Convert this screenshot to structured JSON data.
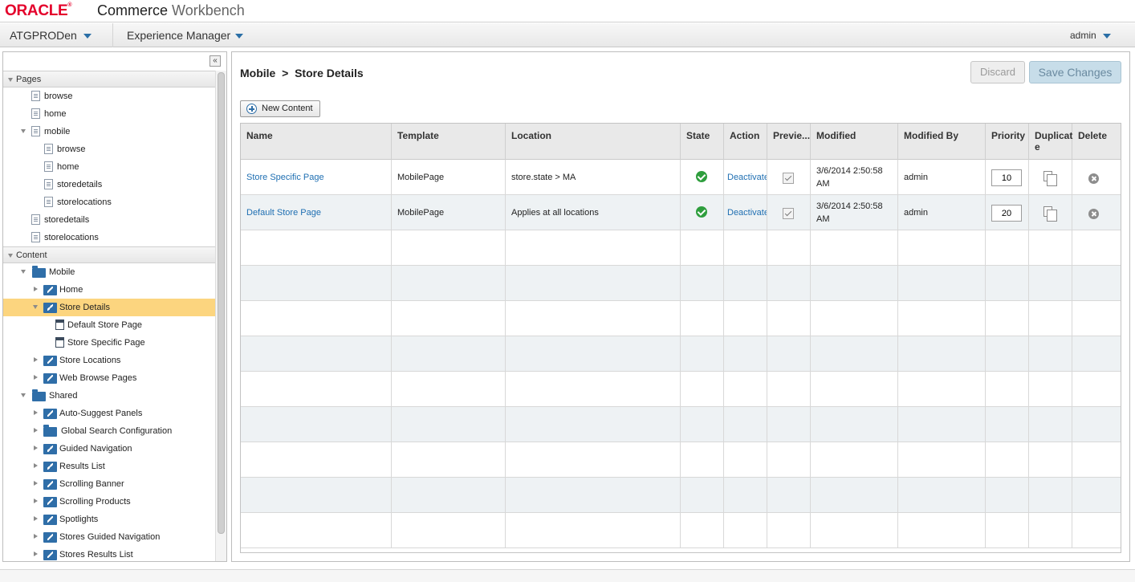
{
  "brand": {
    "oracle": "ORACLE",
    "app_bold": "Commerce",
    "app_light": "Workbench"
  },
  "nav": {
    "site": "ATGPRODen",
    "tool": "Experience Manager",
    "user": "admin"
  },
  "sidebar": {
    "collapse_glyph": "«",
    "pages_header": "Pages",
    "pages": [
      {
        "label": "browse"
      },
      {
        "label": "home"
      },
      {
        "label": "mobile"
      },
      {
        "label": "browse"
      },
      {
        "label": "home"
      },
      {
        "label": "storedetails"
      },
      {
        "label": "storelocations"
      },
      {
        "label": "storedetails"
      },
      {
        "label": "storelocations"
      }
    ],
    "content_header": "Content",
    "content": [
      {
        "label": "Mobile"
      },
      {
        "label": "Home"
      },
      {
        "label": "Store Details"
      },
      {
        "label": "Default Store Page"
      },
      {
        "label": "Store Specific Page"
      },
      {
        "label": "Store Locations"
      },
      {
        "label": "Web Browse Pages"
      },
      {
        "label": "Shared"
      },
      {
        "label": "Auto-Suggest Panels"
      },
      {
        "label": "Global Search Configuration"
      },
      {
        "label": "Guided Navigation"
      },
      {
        "label": "Results List"
      },
      {
        "label": "Scrolling Banner"
      },
      {
        "label": "Scrolling Products"
      },
      {
        "label": "Spotlights"
      },
      {
        "label": "Stores Guided Navigation"
      },
      {
        "label": "Stores Results List"
      }
    ]
  },
  "main": {
    "breadcrumb": "Mobile  >  Store Details",
    "discard": "Discard",
    "save": "Save Changes",
    "new_content": "New Content",
    "columns": [
      "Name",
      "Template",
      "Location",
      "State",
      "Action",
      "Previe...",
      "Modified",
      "Modified By",
      "Priority",
      "Duplicat e",
      "Delete"
    ],
    "rows": [
      {
        "name": "Store Specific Page",
        "template": "MobilePage",
        "location": "store.state > MA",
        "action": "Deactivate",
        "modified_1": "3/6/2014 2:50:58",
        "modified_2": "AM",
        "modified_by": "admin",
        "priority": "10"
      },
      {
        "name": "Default Store Page",
        "template": "MobilePage",
        "location": "Applies at all locations",
        "action": "Deactivate",
        "modified_1": "3/6/2014 2:50:58",
        "modified_2": "AM",
        "modified_by": "admin",
        "priority": "20"
      }
    ]
  },
  "icons": {
    "state": "check-circle-icon",
    "preview": "checkbox-icon",
    "duplicate": "copy-icon",
    "delete": "remove-circle-icon"
  },
  "colors": {
    "oracle_red": "#e4002b",
    "selected_row": "#fcd57f",
    "link": "#1f6fb2",
    "state_ok": "#2e9e3d"
  }
}
